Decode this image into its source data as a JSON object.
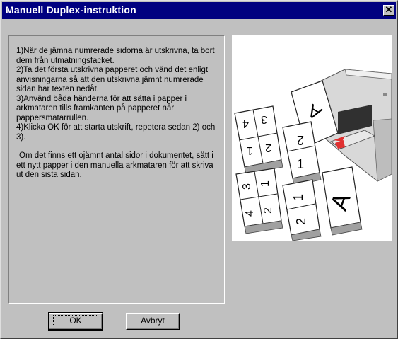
{
  "window": {
    "title": "Manuell Duplex-instruktion",
    "close_glyph": "✕"
  },
  "instructions": {
    "steps": [
      "1)När de jämna numrerade sidorna är utskrivna, ta bort dem från utmatningsfacket.",
      "2)Ta det första utskrivna papperet och vänd det enligt anvisningarna så att den utskrivna jämnt numrerade sidan har texten nedåt.",
      "3)Använd båda händerna för att sätta i papper i arkmataren tills framkanten på papperet når pappersmatarrullen.",
      "4)Klicka OK för att starta utskrift, repetera sedan 2) och 3)."
    ],
    "note": "Om det finns ett ojämnt antal sidor i dokumentet, sätt i ett nytt papper i den manuella arkmataren för att skriva ut den sista sidan."
  },
  "illustration": {
    "labels": [
      "A",
      "4",
      "3",
      "1",
      "2",
      "1",
      "3",
      "1",
      "4",
      "2",
      "1",
      "2",
      "A"
    ],
    "accent_color": "#e03030"
  },
  "buttons": {
    "ok_label": "OK",
    "cancel_label": "Avbryt"
  }
}
